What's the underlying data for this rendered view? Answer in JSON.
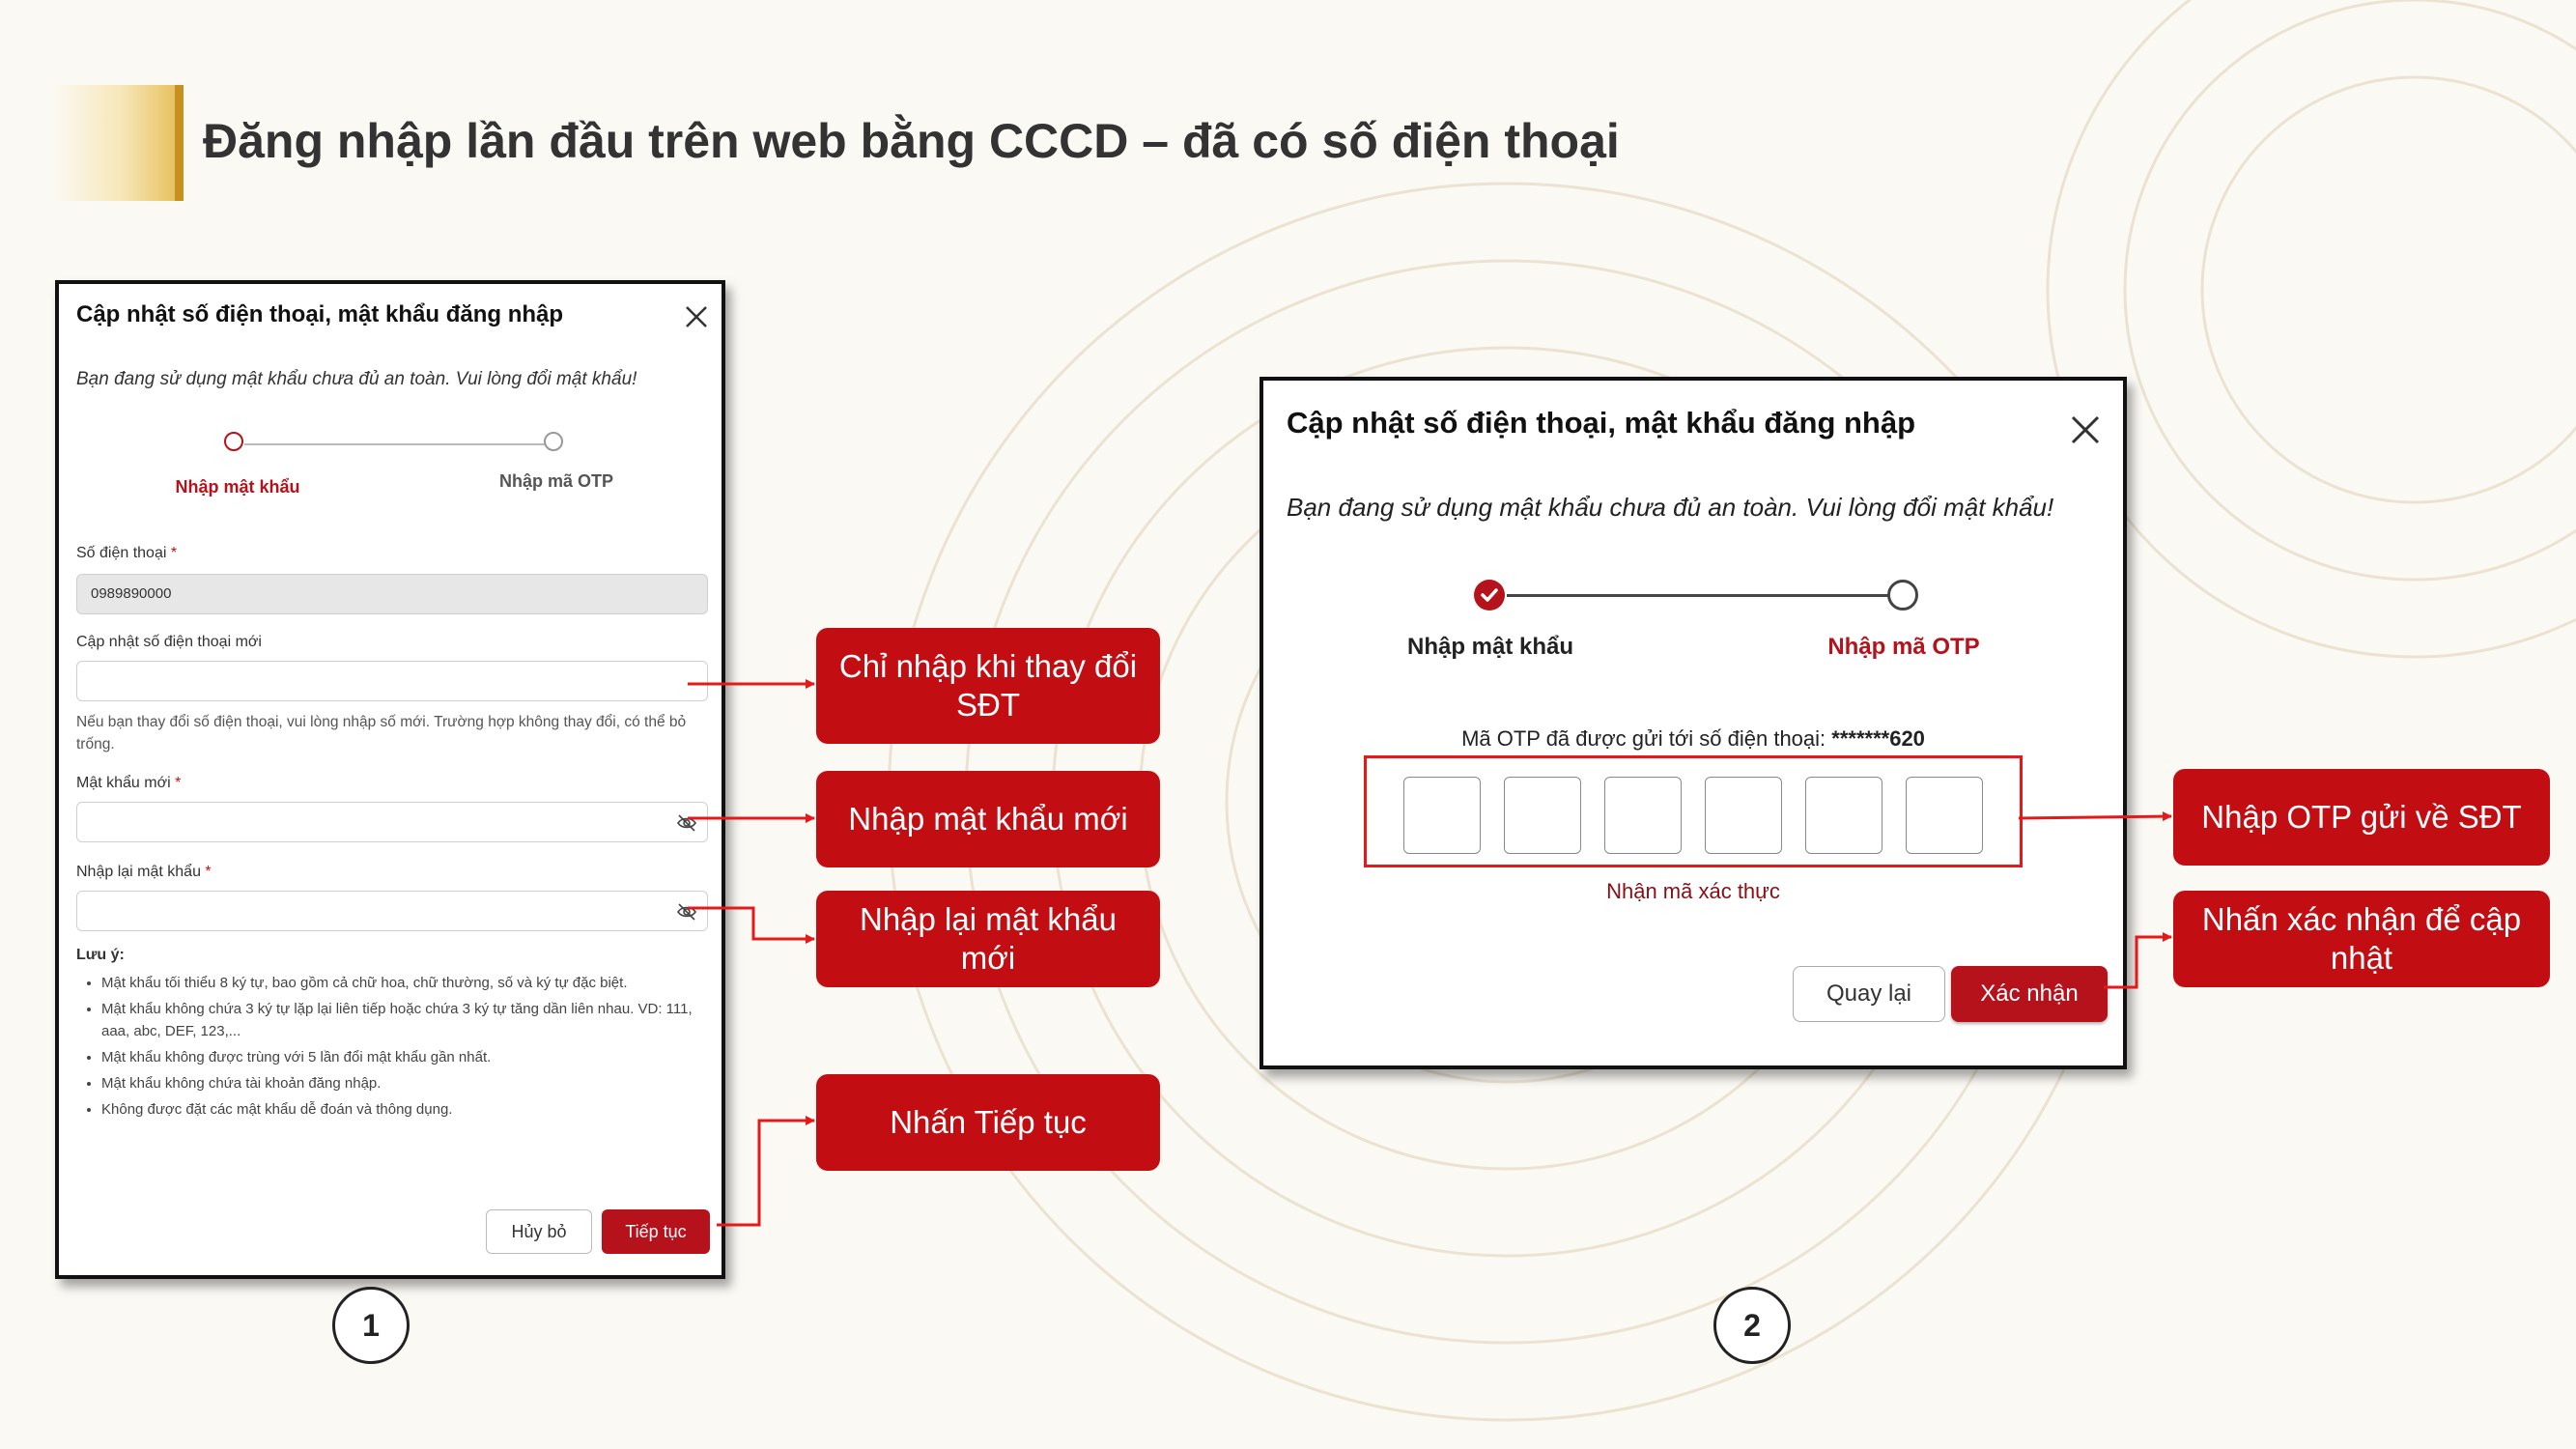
{
  "page": {
    "title": "Đăng nhập lần đầu trên web bằng CCCD – đã có số điện thoại"
  },
  "colors": {
    "brand_red": "#b5121b",
    "callout_red": "#c20e12",
    "title_accent": "#c78f1d"
  },
  "panel1": {
    "title": "Cập nhật số điện thoại, mật khẩu đăng nhập",
    "close_icon": "close-icon",
    "warning": "Bạn đang sử dụng mật khẩu chưa đủ an toàn. Vui lòng đổi mật khẩu!",
    "steps": [
      {
        "label": "Nhập mật khẩu",
        "state": "active"
      },
      {
        "label": "Nhập mã OTP",
        "state": "pending"
      }
    ],
    "phone_label": "Số điện thoại",
    "phone_value": "0989890000",
    "new_phone_label": "Cập nhật số điện thoại mới",
    "new_phone_value": "",
    "new_phone_hint": "Nếu bạn thay đổi số điện thoại, vui lòng nhập số mới. Trường hợp không thay đổi, có thể bỏ trống.",
    "password_label": "Mật khẩu mới",
    "confirm_password_label": "Nhập lại mật khẩu",
    "required_mark": "*",
    "note_title": "Lưu ý:",
    "rules": [
      "Mật khẩu tối thiểu 8 ký tự, bao gồm cả chữ hoa, chữ thường, số và ký tự đặc biệt.",
      "Mật khẩu không chứa 3 ký tự lặp lại liên tiếp hoặc chứa 3 ký tự tăng dần liên nhau. VD: 111, aaa, abc, DEF, 123,...",
      "Mật khẩu không được trùng với 5 lần đổi mật khẩu gần nhất.",
      "Mật khẩu không chứa tài khoản đăng nhập.",
      "Không được đặt các mật khẩu dễ đoán và thông dụng."
    ],
    "cancel_label": "Hủy bỏ",
    "next_label": "Tiếp tục"
  },
  "panel2": {
    "title": "Cập nhật số điện thoại, mật khẩu đăng nhập",
    "close_icon": "close-icon",
    "warning": "Bạn đang sử dụng mật khẩu chưa đủ an toàn. Vui lòng đổi mật khẩu!",
    "steps": [
      {
        "label": "Nhập mật khẩu",
        "state": "done"
      },
      {
        "label": "Nhập mã OTP",
        "state": "active"
      }
    ],
    "otp_message": "Mã OTP đã được gửi tới số điện thoại:",
    "masked_phone": "*******620",
    "otp_digits": [
      "",
      "",
      "",
      "",
      "",
      ""
    ],
    "otp_label": "Nhận mã xác thực",
    "back_label": "Quay lại",
    "confirm_label": "Xác nhận"
  },
  "callouts": [
    "Chỉ nhập khi thay đổi SĐT",
    "Nhập mật khẩu mới",
    "Nhập lại mật khẩu mới",
    "Nhấn Tiếp tục",
    "Nhập OTP gửi về SĐT",
    "Nhấn xác nhận để cập nhật"
  ],
  "step_numbers": [
    "1",
    "2"
  ]
}
